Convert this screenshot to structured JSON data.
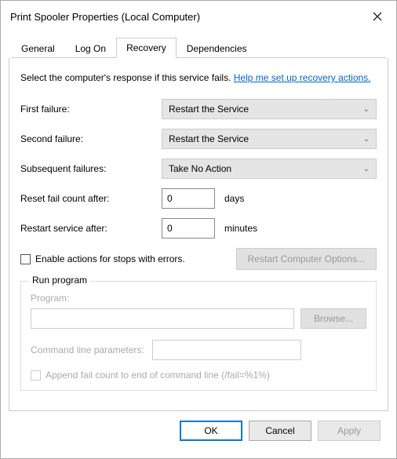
{
  "window": {
    "title": "Print Spooler Properties (Local Computer)"
  },
  "tabs": {
    "general": "General",
    "logon": "Log On",
    "recovery": "Recovery",
    "dependencies": "Dependencies"
  },
  "intro": {
    "text": "Select the computer's response if this service fails. ",
    "link": "Help me set up recovery actions."
  },
  "labels": {
    "first": "First failure:",
    "second": "Second failure:",
    "subsequent": "Subsequent failures:",
    "reset": "Reset fail count after:",
    "restart": "Restart service after:",
    "days": "days",
    "minutes": "minutes",
    "enableActions": "Enable actions for stops with errors.",
    "restartOptions": "Restart Computer Options...",
    "runProgram": "Run program",
    "program": "Program:",
    "browse": "Browse...",
    "cmdParams": "Command line parameters:",
    "append": "Append fail count to end of command line (/fail=%1%)"
  },
  "values": {
    "first": "Restart the Service",
    "second": "Restart the Service",
    "subsequent": "Take No Action",
    "resetDays": "0",
    "restartMinutes": "0",
    "program": "",
    "cmdParams": ""
  },
  "footer": {
    "ok": "OK",
    "cancel": "Cancel",
    "apply": "Apply"
  }
}
